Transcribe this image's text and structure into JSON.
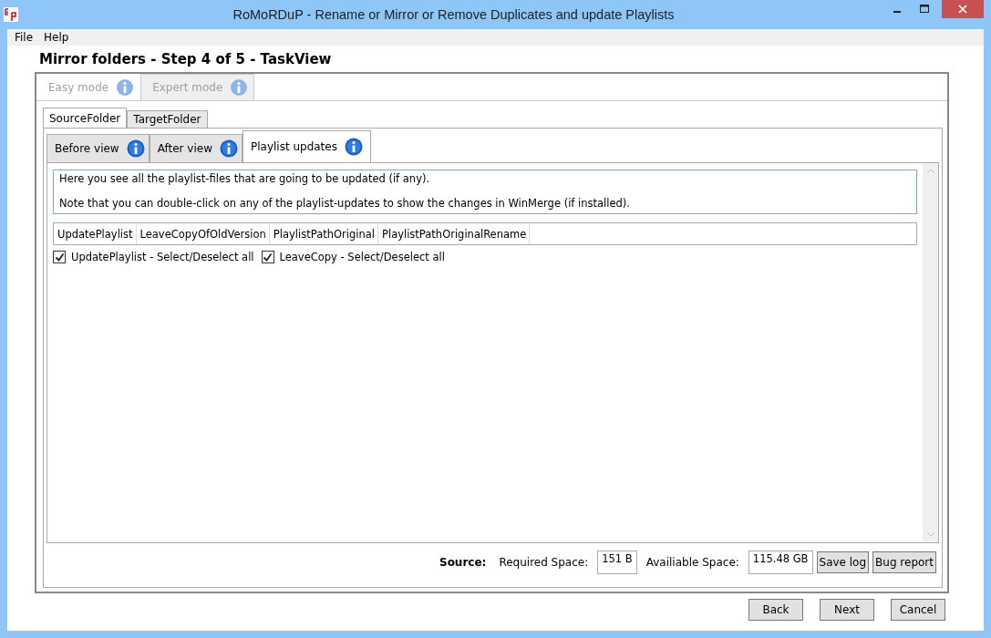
{
  "window": {
    "title": "RoMoRDuP - Rename or Mirror or Remove Duplicates and update Playlists"
  },
  "menu": [
    "File",
    "Help"
  ],
  "heading": "Mirror folders - Step 4 of 5 - TaskView",
  "mode_tabs": [
    {
      "label": "Easy mode",
      "selected": true,
      "disabled": true
    },
    {
      "label": "Expert mode",
      "selected": false,
      "disabled": true
    }
  ],
  "folder_tabs": [
    {
      "label": "SourceFolder",
      "selected": true
    },
    {
      "label": "TargetFolder",
      "selected": false
    }
  ],
  "view_tabs": [
    {
      "label": "Before view",
      "selected": false
    },
    {
      "label": "After view",
      "selected": false
    },
    {
      "label": "Playlist updates",
      "selected": true
    }
  ],
  "description": [
    "Here you see all the playlist-files that are going to be updated (if any).",
    "Note that you can double-click on any of the playlist-updates to show the changes in WinMerge (if installed)."
  ],
  "table": {
    "columns": [
      "UpdatePlaylist",
      "LeaveCopyOfOldVersion",
      "PlaylistPathOriginal",
      "PlaylistPathOriginalRename"
    ]
  },
  "select_all": [
    {
      "label": "UpdatePlaylist - Select/Deselect all",
      "checked": true
    },
    {
      "label": "LeaveCopy - Select/Deselect all",
      "checked": true
    }
  ],
  "footer": {
    "source_label": "Source:",
    "required_label": "Required Space:",
    "required_value": "151 B",
    "available_label": "Availiable Space:",
    "available_value": "115.48 GB",
    "buttons": [
      "Save log",
      "Bug report"
    ]
  },
  "buttons": [
    "Back",
    "Next",
    "Cancel"
  ]
}
